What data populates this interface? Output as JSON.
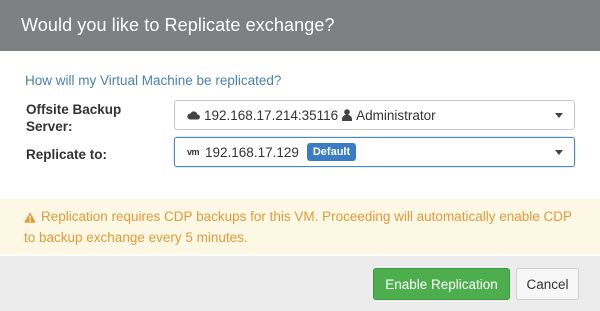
{
  "dialog": {
    "title": "Would you like to Replicate exchange?",
    "question": "How will my Virtual Machine be replicated?",
    "backup_label_line1": "Offsite Backup",
    "backup_label_line2": "Server:",
    "backup_server": {
      "icon": "cloud-icon",
      "address": "192.168.17.214:35116",
      "user_icon": "user-icon",
      "user": "Administrator"
    },
    "replicate_label": "Replicate to:",
    "replicate_target": {
      "icon": "vm-icon",
      "icon_text": "vm",
      "address": "192.168.17.129",
      "badge": "Default"
    },
    "alert": {
      "icon": "warning-icon",
      "text": "Replication requires CDP backups for this VM. Proceeding will automatically enable CDP to backup exchange every 5 minutes."
    },
    "buttons": {
      "primary": "Enable Replication",
      "secondary": "Cancel"
    }
  },
  "colors": {
    "header_bg": "#7d8184",
    "link": "#4a7fb0",
    "badge": "#3a7dc4",
    "alert_bg": "#fcf8e3",
    "alert_text": "#e09a3d",
    "primary_button": "#4cae4c"
  }
}
